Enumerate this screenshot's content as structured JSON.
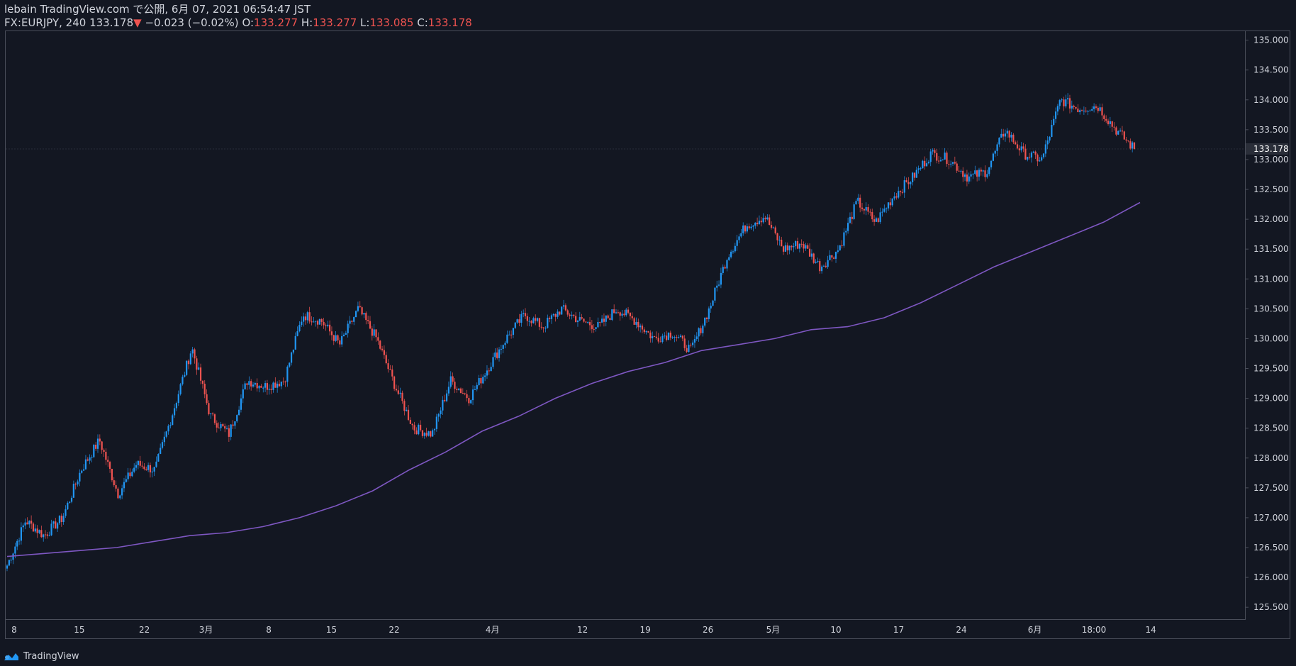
{
  "header": {
    "published": "lebain TradingView.com で公開, 6月 07, 2021 06:54:47 JST",
    "symbol": "FX:EURJPY, 240",
    "last": "133.178",
    "change_arrow": "▼",
    "change": "−0.023 (−0.02%)",
    "o_label": "O:",
    "o": "133.277",
    "h_label": "H:",
    "h": "133.277",
    "l_label": "L:",
    "l": "133.085",
    "c_label": "C:",
    "c": "133.178"
  },
  "footer": {
    "brand": "TradingView"
  },
  "colors": {
    "background": "#131722",
    "up": "#2196f3",
    "down": "#ef5350",
    "moving_average": "#7e57c2",
    "border": "#4a4e5a",
    "text": "#d1d4dc"
  },
  "chart_data": {
    "type": "line",
    "title": "FX:EURJPY, 240",
    "grid": false,
    "ylim": [
      125.3,
      135.15
    ],
    "y_ticks": [
      "135.000",
      "134.500",
      "134.000",
      "133.500",
      "133.000",
      "132.500",
      "132.000",
      "131.500",
      "131.000",
      "130.500",
      "130.000",
      "129.500",
      "129.000",
      "128.500",
      "128.000",
      "127.500",
      "127.000",
      "126.500",
      "126.000",
      "125.500"
    ],
    "x_ticks": [
      "8",
      "15",
      "22",
      "3月",
      "8",
      "15",
      "22",
      "4月",
      "12",
      "19",
      "26",
      "5月",
      "10",
      "17",
      "24",
      "6月",
      "18:00",
      "14"
    ],
    "last_price_label": "133.178",
    "last_price": 133.178,
    "series": [
      {
        "style": "candles",
        "x": [
          "2/8",
          "2/10",
          "2/12",
          "2/15",
          "2/16",
          "2/17",
          "2/18",
          "2/19",
          "2/22",
          "2/24",
          "2/25",
          "2/26",
          "3/1",
          "3/2",
          "3/3",
          "3/5",
          "3/8",
          "3/10",
          "3/12",
          "3/15",
          "3/17",
          "3/18",
          "3/19",
          "3/22",
          "3/24",
          "3/25",
          "3/26",
          "3/29",
          "3/31",
          "4/2",
          "4/5",
          "4/7",
          "4/9",
          "4/12",
          "4/14",
          "4/16",
          "4/19",
          "4/21",
          "4/23",
          "4/26",
          "4/27",
          "4/28",
          "4/29",
          "4/30",
          "5/3",
          "5/5",
          "5/7",
          "5/10",
          "5/12",
          "5/14",
          "5/17",
          "5/19",
          "5/21",
          "5/24",
          "5/25",
          "5/26",
          "5/27",
          "5/28",
          "5/31",
          "6/2",
          "6/4",
          "6/7"
        ],
        "values": [
          126.2,
          126.95,
          126.7,
          127.0,
          127.8,
          128.3,
          127.4,
          127.9,
          127.8,
          128.8,
          129.85,
          128.7,
          128.4,
          129.3,
          129.2,
          129.3,
          130.4,
          130.3,
          129.9,
          130.5,
          130.0,
          129.2,
          128.5,
          128.4,
          129.3,
          129.0,
          129.5,
          130.0,
          130.4,
          130.2,
          130.5,
          130.3,
          130.2,
          130.5,
          130.3,
          130.0,
          130.1,
          129.8,
          130.5,
          131.4,
          131.9,
          132.05,
          131.5,
          131.6,
          131.2,
          131.5,
          132.3,
          131.95,
          132.4,
          132.7,
          133.1,
          133.0,
          132.7,
          132.8,
          133.5,
          133.1,
          133.0,
          134.0,
          133.85,
          133.9,
          133.5,
          133.178
        ]
      },
      {
        "style": "line",
        "values": [
          126.35,
          126.4,
          126.45,
          126.5,
          126.6,
          126.7,
          126.75,
          126.85,
          127.0,
          127.2,
          127.45,
          127.8,
          128.1,
          128.45,
          128.7,
          129.0,
          129.25,
          129.45,
          129.6,
          129.8,
          129.9,
          130.0,
          130.15,
          130.2,
          130.35,
          130.6,
          130.9,
          131.2,
          131.45,
          131.7,
          131.95,
          132.28
        ]
      }
    ]
  }
}
